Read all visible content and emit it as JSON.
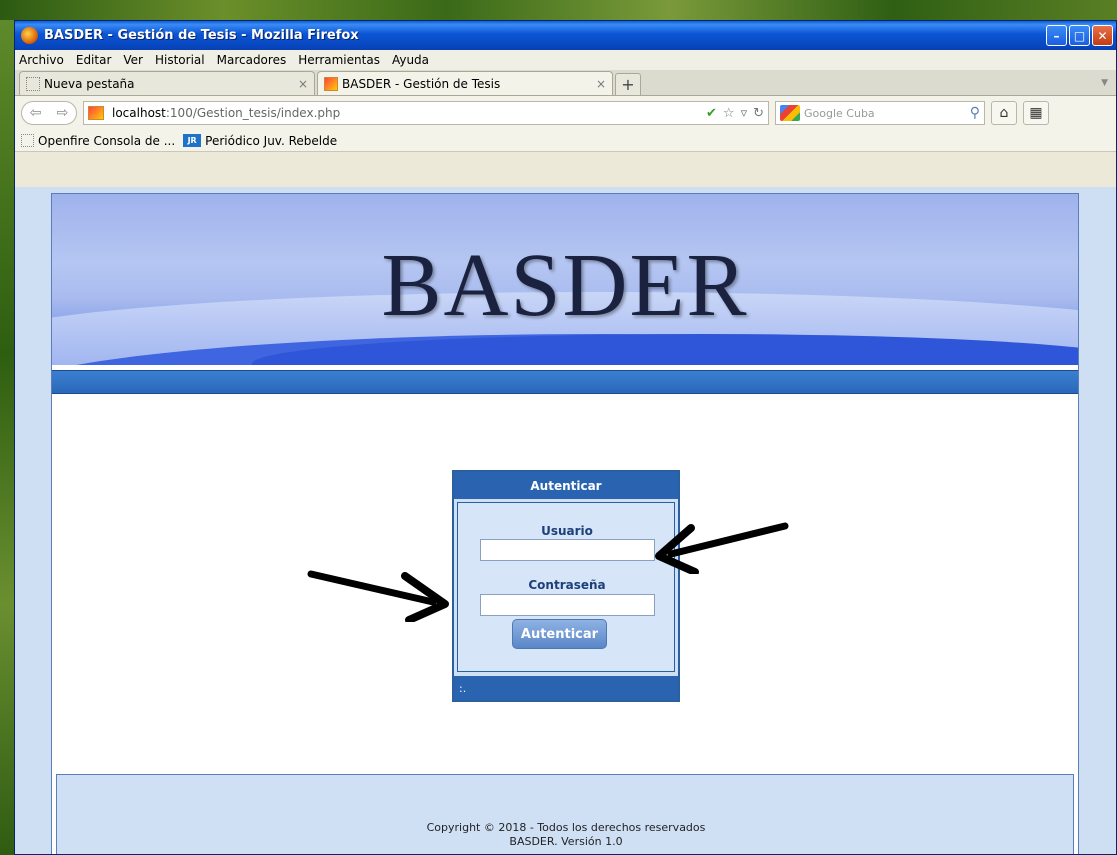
{
  "window": {
    "title": "BASDER - Gestión de Tesis - Mozilla Firefox",
    "minimize": "–",
    "maximize": "□",
    "close": "✕"
  },
  "menu": [
    "Archivo",
    "Editar",
    "Ver",
    "Historial",
    "Marcadores",
    "Herramientas",
    "Ayuda"
  ],
  "tabs": [
    {
      "label": "Nueva pestaña",
      "close": "×"
    },
    {
      "label": "BASDER - Gestión de Tesis",
      "close": "×"
    }
  ],
  "newtab_label": "+",
  "address": {
    "host": "localhost",
    "path": ":100/Gestion_tesis/index.php"
  },
  "search": {
    "placeholder": "Google Cuba"
  },
  "bookmarks": [
    {
      "label": "Openfire Consola de ..."
    },
    {
      "label": "Periódico Juv. Rebelde",
      "icon_text": "JR"
    }
  ],
  "page": {
    "banner_title": "BASDER",
    "login": {
      "header": "Autenticar",
      "user_label": "Usuario",
      "pass_label": "Contraseña",
      "button": "Autenticar",
      "footer": ":."
    },
    "footer": {
      "line1": "Copyright © 2018 - Todos los derechos reservados",
      "line2": "BASDER. Versión 1.0"
    }
  },
  "colors": {
    "titlebar": "#0b55d4",
    "login_header": "#2a64b0",
    "page_bg": "#cfdff3"
  }
}
